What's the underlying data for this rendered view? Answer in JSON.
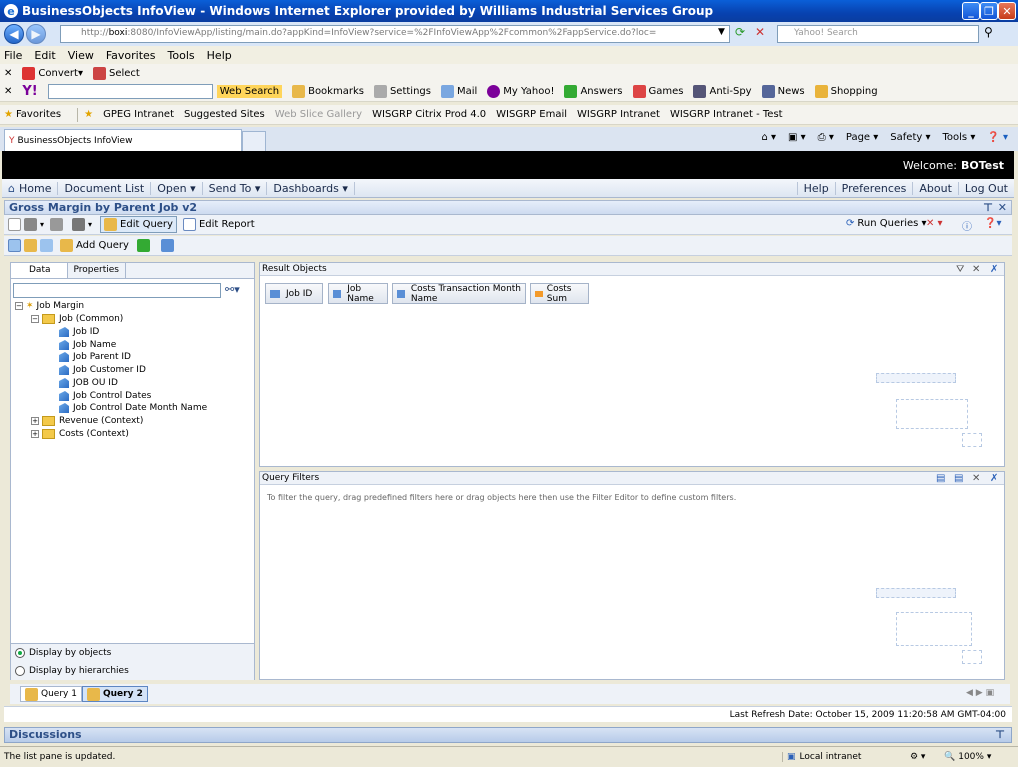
{
  "window": {
    "title": "BusinessObjects InfoView - Windows Internet Explorer provided by Williams Industrial Services Group",
    "minimize": "_",
    "maximize": "❐",
    "close": "✕"
  },
  "address": {
    "url_prefix": "http://",
    "url_host": "boxi",
    "url_rest": ":8080/InfoViewApp/listing/main.do?appKind=InfoView?service=%2FInfoViewApp%2Fcommon%2FappService.do?loc=",
    "search_placeholder": "Yahoo! Search"
  },
  "menu": [
    "File",
    "Edit",
    "View",
    "Favorites",
    "Tools",
    "Help"
  ],
  "convert_bar": {
    "convert": "Convert",
    "select": "Select"
  },
  "yahoo_bar": {
    "web_search": "Web Search",
    "bookmarks": "Bookmarks",
    "settings": "Settings",
    "mail": "Mail",
    "my_yahoo": "My Yahoo!",
    "answers": "Answers",
    "games": "Games",
    "anti_spy": "Anti-Spy",
    "news": "News",
    "shopping": "Shopping"
  },
  "favorites_bar": {
    "favorites": "Favorites",
    "items": [
      "GPEG Intranet",
      "Suggested Sites",
      "Web Slice Gallery",
      "WISGRP Citrix Prod 4.0",
      "WISGRP Email",
      "WISGRP Intranet",
      "WISGRP Intranet - Test"
    ]
  },
  "tab": {
    "label": "BusinessObjects InfoView"
  },
  "ie_tools": {
    "page": "Page",
    "safety": "Safety",
    "tools": "Tools"
  },
  "app_header": {
    "welcome": "Welcome:",
    "user": "BOTest"
  },
  "app_nav": {
    "home": "Home",
    "document_list": "Document List",
    "open": "Open",
    "send_to": "Send To",
    "dashboards": "Dashboards",
    "help": "Help",
    "preferences": "Preferences",
    "about": "About",
    "log_out": "Log Out"
  },
  "document": {
    "title": "Gross Margin by Parent Job v2",
    "edit_query": "Edit Query",
    "edit_report": "Edit Report",
    "run_queries": "Run Queries",
    "add_query": "Add Query"
  },
  "left_panel": {
    "tab_data": "Data",
    "tab_properties": "Properties",
    "tree": {
      "root": "Job Margin",
      "folder": "Job (Common)",
      "items": [
        "Job ID",
        "Job Name",
        "Job Parent ID",
        "Job Customer ID",
        "JOB OU ID",
        "Job Control Dates",
        "Job Control Date Month Name"
      ],
      "other_folders": [
        "Revenue (Context)",
        "Costs (Context)"
      ]
    },
    "display_by_objects": "Display by objects",
    "display_by_hierarchies": "Display by hierarchies"
  },
  "result_objects": {
    "title": "Result Objects",
    "chips": [
      {
        "label": "Job ID",
        "kind": "dimension"
      },
      {
        "label": "Job Name",
        "kind": "dimension"
      },
      {
        "label": "Costs Transaction Month Name",
        "kind": "dimension"
      },
      {
        "label": "Costs Sum",
        "kind": "measure"
      }
    ]
  },
  "query_filters": {
    "title": "Query Filters",
    "hint": "To filter the query, drag predefined filters here or drag objects here then use the Filter Editor to define custom filters."
  },
  "query_tabs": [
    "Query 1",
    "Query 2"
  ],
  "refresh": "Last Refresh Date: October 15, 2009 11:20:58 AM GMT-04:00",
  "discussions": "Discussions",
  "status": {
    "message": "The list pane is updated.",
    "zone": "Local intranet",
    "zoom": "100%"
  },
  "colors": {
    "titlebar": "#0842b0",
    "app_header": "#000000",
    "accent": "#2d4f87",
    "measure": "#f39a2a",
    "dimension": "#5a8fd6"
  }
}
